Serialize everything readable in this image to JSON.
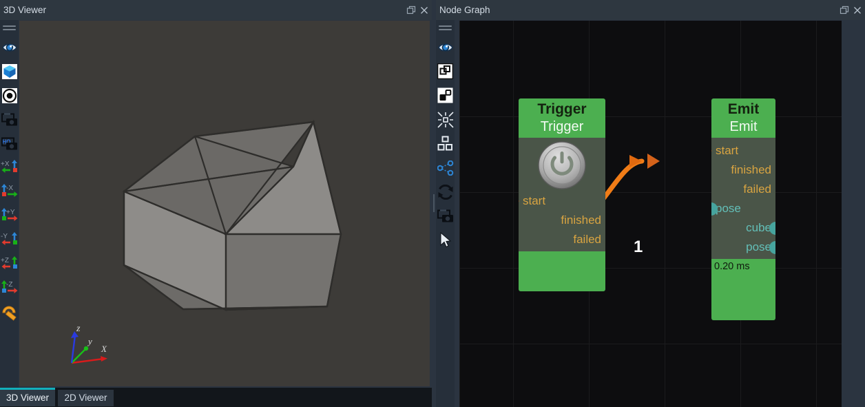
{
  "window": {
    "background": "#1b1f24"
  },
  "panels": {
    "viewer3d": {
      "title": "3D Viewer",
      "float_icon": "float-restore-icon",
      "close_icon": "close-icon",
      "toolbar": {
        "grip": "drag-grip-icon",
        "items": [
          {
            "name": "eye-visibility-icon",
            "tooltip": "Visibility"
          },
          {
            "name": "cube-blue-icon",
            "tooltip": "Show Cube"
          },
          {
            "name": "target-focus-icon",
            "tooltip": "Focus"
          },
          {
            "name": "screenshot-icon",
            "tooltip": "Screenshot"
          },
          {
            "name": "screenshot-hq-icon",
            "tooltip": "HQ Screenshot"
          },
          {
            "name": "view-plus-x-icon",
            "label": "+X"
          },
          {
            "name": "view-minus-x-icon",
            "label": "-X"
          },
          {
            "name": "view-plus-y-icon",
            "label": "+Y"
          },
          {
            "name": "view-minus-y-icon",
            "label": "-Y"
          },
          {
            "name": "view-plus-z-icon",
            "label": "+Z"
          },
          {
            "name": "view-minus-z-icon",
            "label": "-Z"
          },
          {
            "name": "measure-protractor-icon",
            "tooltip": "Measure"
          }
        ]
      },
      "scene": {
        "background": "#3d3b38",
        "object": "wireframe-cube",
        "axis_gizmo": {
          "x_label": "X",
          "x_color": "#d81b1b",
          "y_label": "Y",
          "y_color": "#18c018",
          "z_label": "Z",
          "z_color": "#2a3ae0"
        }
      }
    },
    "nodegraph": {
      "title": "Node Graph",
      "float_icon": "float-restore-icon",
      "close_icon": "close-icon",
      "toolbar": {
        "grip": "drag-grip-icon",
        "items": [
          {
            "name": "eye-visibility-icon",
            "tooltip": "Visibility"
          },
          {
            "name": "frame-selection-icon",
            "tooltip": "Frame Selection",
            "active": true
          },
          {
            "name": "group-nodes-icon",
            "tooltip": "Group Nodes",
            "active": true
          },
          {
            "name": "collapse-icon",
            "tooltip": "Collapse"
          },
          {
            "name": "layout-grid-icon",
            "tooltip": "Auto Layout"
          },
          {
            "name": "share-graph-icon",
            "tooltip": "Share"
          },
          {
            "name": "refresh-icon",
            "tooltip": "Refresh"
          },
          {
            "name": "screenshot-icon",
            "tooltip": "Screenshot"
          },
          {
            "name": "cursor-select-icon",
            "tooltip": "Select Tool"
          }
        ]
      }
    }
  },
  "graph": {
    "background": "#0d0d0f",
    "grid_color": "#1b1b1d",
    "nodes": [
      {
        "id": "trigger",
        "title": "Trigger",
        "subtitle": "Trigger",
        "header_color": "#4caf50",
        "body_color": "#4a5548",
        "widget": "power-button",
        "inputs": [
          {
            "label": "start",
            "kind": "exec"
          }
        ],
        "outputs": [
          {
            "label": "finished",
            "kind": "exec"
          },
          {
            "label": "failed",
            "kind": "exec"
          }
        ],
        "footer": ""
      },
      {
        "id": "emit",
        "title": "Emit",
        "subtitle": "Emit",
        "header_color": "#4caf50",
        "body_color": "#4a5548",
        "inputs": [
          {
            "label": "start",
            "kind": "exec"
          },
          {
            "label": "pose",
            "kind": "data"
          }
        ],
        "outputs": [
          {
            "label": "finished",
            "kind": "exec"
          },
          {
            "label": "failed",
            "kind": "exec"
          },
          {
            "label": "cube",
            "kind": "data"
          },
          {
            "label": "pose",
            "kind": "data"
          }
        ],
        "footer": "0.20 ms"
      }
    ],
    "connections": [
      {
        "from": "trigger.finished",
        "to": "emit.start",
        "label": "1",
        "color": "#f07c17"
      }
    ]
  },
  "tabs": [
    {
      "label": "3D Viewer",
      "active": true
    },
    {
      "label": "2D Viewer",
      "active": false
    }
  ],
  "colors": {
    "accent_teal": "#12b0bb",
    "node_green": "#4caf50",
    "exec_orange": "#d4621a",
    "data_teal": "#46a49e",
    "label_orange": "#d9a441",
    "connection_orange": "#f07c17"
  }
}
